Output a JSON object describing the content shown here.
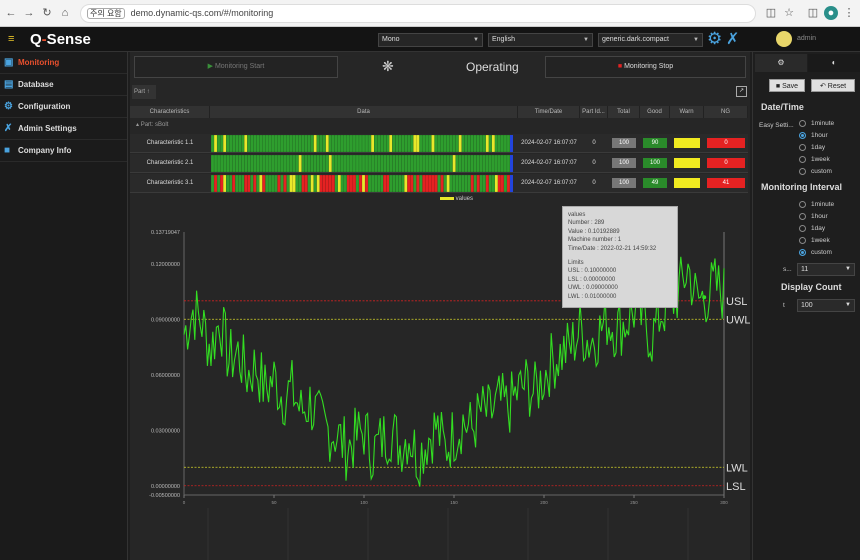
{
  "browser": {
    "url": "demo.dynamic-qs.com/#/monitoring",
    "security": "주의 요함"
  },
  "app": {
    "logo_q": "Q",
    "logo_dash": "-",
    "logo_s": "S",
    "logo_rest": "ense",
    "user": "admin"
  },
  "header": {
    "select_1": "Mono",
    "select_2": "English",
    "select_3": "generic.dark.compact"
  },
  "sidebar": {
    "items": [
      {
        "label": "Monitoring",
        "icon": "monitor-icon"
      },
      {
        "label": "Database",
        "icon": "database-icon"
      },
      {
        "label": "Configuration",
        "icon": "gear-icon"
      },
      {
        "label": "Admin Settings",
        "icon": "tools-icon"
      },
      {
        "label": "Company Info",
        "icon": "info-icon"
      }
    ]
  },
  "controls": {
    "start": "Monitoring Start",
    "status": "Operating",
    "stop": "Monitoring Stop",
    "part": "Part"
  },
  "table": {
    "headers": [
      "Characteristics",
      "Data",
      "Time/Date",
      "Part Id...",
      "Total",
      "Good",
      "Warn",
      "NG"
    ],
    "group": "Part: sBolt",
    "rows": [
      {
        "name": "Characteristic 1.1",
        "time": "2024-02-07 16:07:07",
        "part": "0",
        "total": "100",
        "good": "90",
        "warn": "",
        "ng": "0"
      },
      {
        "name": "Characteristic 2.1",
        "time": "2024-02-07 16:07:07",
        "part": "0",
        "total": "100",
        "good": "100",
        "warn": "",
        "ng": "0"
      },
      {
        "name": "Characteristic 3.1",
        "time": "2024-02-07 16:07:07",
        "part": "0",
        "total": "100",
        "good": "49",
        "warn": "",
        "ng": "41"
      }
    ],
    "legend": "values"
  },
  "colors": {
    "good": "#2e9e2e",
    "warn": "#e8e82a",
    "ng": "#e52222",
    "accent": "#e8502e",
    "line": "#33dd22"
  },
  "tooltip": {
    "title": "values",
    "number": "Number : 289",
    "value": "Value : 0.10192889",
    "machine": "Machine number : 1",
    "time": "Time/Date : 2022-02-21 14:59:32",
    "limits": "Limits",
    "usl": "USL : 0.10000000",
    "lsl": "LSL : 0.00000000",
    "uwl": "UWL : 0.09000000",
    "lwl": "LWL : 0.01000000"
  },
  "chart_data": {
    "type": "line",
    "ylim": [
      -0.005,
      0.13719047
    ],
    "yticks": [
      "0.13719047",
      "0.12000000",
      "0.09000000",
      "0.06000000",
      "0.03000000",
      "0.00000000",
      "-0.00500000"
    ],
    "ytick_values": [
      0.13719047,
      0.12,
      0.09,
      0.06,
      0.03,
      0.0,
      -0.005
    ],
    "limits": [
      {
        "name": "USL",
        "value": 0.1,
        "color": "#cc2222"
      },
      {
        "name": "UWL",
        "value": 0.09,
        "color": "#d4d42a"
      },
      {
        "name": "LWL",
        "value": 0.01,
        "color": "#d4d42a"
      },
      {
        "name": "LSL",
        "value": 0.0,
        "color": "#cc2222"
      }
    ],
    "xlim": [
      0,
      300
    ],
    "xticks": [
      0,
      50,
      100,
      150,
      200,
      250,
      300
    ],
    "series": [
      {
        "name": "values",
        "anchors": [
          [
            0,
            0.082
          ],
          [
            5,
            0.095
          ],
          [
            10,
            0.088
          ],
          [
            15,
            0.074
          ],
          [
            20,
            0.09
          ],
          [
            25,
            0.068
          ],
          [
            30,
            0.072
          ],
          [
            35,
            0.06
          ],
          [
            40,
            0.065
          ],
          [
            45,
            0.052
          ],
          [
            50,
            0.058
          ],
          [
            55,
            0.048
          ],
          [
            60,
            0.052
          ],
          [
            65,
            0.04
          ],
          [
            70,
            0.045
          ],
          [
            75,
            0.035
          ],
          [
            80,
            0.03
          ],
          [
            85,
            0.028
          ],
          [
            90,
            0.02
          ],
          [
            95,
            0.025
          ],
          [
            100,
            0.03
          ],
          [
            105,
            0.018
          ],
          [
            110,
            0.025
          ],
          [
            115,
            0.03
          ],
          [
            120,
            0.022
          ],
          [
            125,
            0.028
          ],
          [
            130,
            0.015
          ],
          [
            135,
            0.025
          ],
          [
            140,
            0.032
          ],
          [
            145,
            0.02
          ],
          [
            150,
            0.028
          ],
          [
            155,
            0.035
          ],
          [
            160,
            0.03
          ],
          [
            165,
            0.04
          ],
          [
            170,
            0.038
          ],
          [
            175,
            0.045
          ],
          [
            180,
            0.042
          ],
          [
            185,
            0.05
          ],
          [
            190,
            0.055
          ],
          [
            195,
            0.05
          ],
          [
            200,
            0.06
          ],
          [
            205,
            0.068
          ],
          [
            210,
            0.072
          ],
          [
            215,
            0.075
          ],
          [
            220,
            0.085
          ],
          [
            225,
            0.078
          ],
          [
            230,
            0.082
          ],
          [
            235,
            0.09
          ],
          [
            240,
            0.085
          ],
          [
            245,
            0.088
          ],
          [
            250,
            0.095
          ],
          [
            255,
            0.09
          ],
          [
            260,
            0.08
          ],
          [
            265,
            0.094
          ],
          [
            270,
            0.098
          ],
          [
            275,
            0.105
          ],
          [
            280,
            0.118
          ],
          [
            285,
            0.1
          ],
          [
            289,
            0.1019
          ],
          [
            295,
            0.108
          ],
          [
            300,
            0.104
          ]
        ]
      }
    ]
  }
}
